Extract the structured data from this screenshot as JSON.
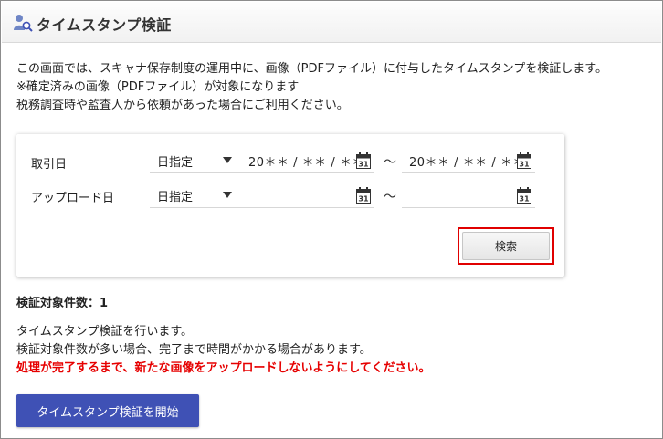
{
  "header": {
    "title": "タイムスタンプ検証",
    "icon": "person-search-icon"
  },
  "description": {
    "line1": "この画面では、スキャナ保存制度の運用中に、画像（PDFファイル）に付与したタイムスタンプを検証します。",
    "line2": "※確定済みの画像（PDFファイル）が対象になります",
    "line3": "税務調査時や監査人から依頼があった場合にご利用ください。"
  },
  "filters": {
    "transaction_date": {
      "label": "取引日",
      "mode": "日指定",
      "from_value": "20＊＊ / ＊＊ / ＊＊",
      "to_value": "20＊＊ / ＊＊ / ＊＊",
      "separator": "～"
    },
    "upload_date": {
      "label": "アップロード日",
      "mode": "日指定",
      "from_value": "",
      "to_value": "",
      "separator": "～"
    },
    "calendar_icon_text": "31"
  },
  "search_button": {
    "label": "検索"
  },
  "count": {
    "text": "検証対象件数：1"
  },
  "message": {
    "line1": "タイムスタンプ検証を行います。",
    "line2": "検証対象件数が多い場合、完了まで時間がかかる場合があります。",
    "warning": "処理が完了するまで、新たな画像をアップロードしないようにしてください。"
  },
  "start_button": {
    "label": "タイムスタンプ検証を開始"
  },
  "colors": {
    "primary": "#3f51b5",
    "warning": "#e60000",
    "highlight_border": "#e00000"
  }
}
